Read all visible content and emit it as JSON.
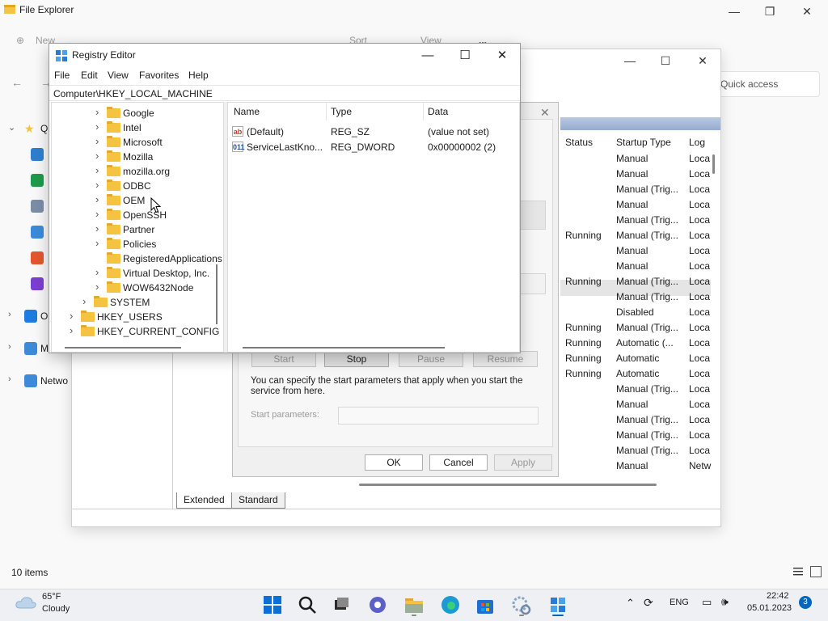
{
  "file_explorer": {
    "title": "File Explorer",
    "toolbar": {
      "new": "New",
      "sort": "Sort",
      "view": "View",
      "more": "..."
    },
    "quick_access": "Quick access",
    "nav": [
      {
        "label": "Q",
        "icon": "star-icon",
        "color": "#f5c342"
      },
      {
        "label": "",
        "icon": "desktop-icon",
        "color": "#2f7fd0"
      },
      {
        "label": "",
        "icon": "downloads-icon",
        "color": "#1e9b4b"
      },
      {
        "label": "",
        "icon": "documents-icon",
        "color": "#7b8ea8"
      },
      {
        "label": "",
        "icon": "pictures-icon",
        "color": "#3a8bdc"
      },
      {
        "label": "",
        "icon": "music-icon",
        "color": "#e4572e"
      },
      {
        "label": "",
        "icon": "videos-icon",
        "color": "#7b3fd1"
      },
      {
        "label": "O",
        "icon": "onedrive-icon",
        "color": "#1e7be0"
      },
      {
        "label": "M",
        "icon": "this-pc-icon",
        "color": "#3d8bd8"
      },
      {
        "label": "Netwo",
        "icon": "network-icon",
        "color": "#3d8bd8"
      }
    ],
    "status": "10 items"
  },
  "services": {
    "headers": {
      "status": "Status",
      "startup": "Startup Type",
      "log": "Log"
    },
    "rows": [
      {
        "status": "",
        "startup": "Manual",
        "log": "Loca"
      },
      {
        "status": "",
        "startup": "Manual",
        "log": "Loca"
      },
      {
        "status": "",
        "startup": "Manual (Trig...",
        "log": "Loca"
      },
      {
        "status": "",
        "startup": "Manual",
        "log": "Loca"
      },
      {
        "status": "",
        "startup": "Manual (Trig...",
        "log": "Loca"
      },
      {
        "status": "Running",
        "startup": "Manual (Trig...",
        "log": "Loca"
      },
      {
        "status": "",
        "startup": "Manual",
        "log": "Loca"
      },
      {
        "status": "",
        "startup": "Manual",
        "log": "Loca"
      },
      {
        "status": "Running",
        "startup": "Manual (Trig...",
        "log": "Loca"
      },
      {
        "status": "",
        "startup": "Manual (Trig...",
        "log": "Loca"
      },
      {
        "status": "",
        "startup": "Disabled",
        "log": "Loca"
      },
      {
        "status": "Running",
        "startup": "Manual (Trig...",
        "log": "Loca"
      },
      {
        "status": "Running",
        "startup": "Automatic (...",
        "log": "Loca"
      },
      {
        "status": "Running",
        "startup": "Automatic",
        "log": "Loca"
      },
      {
        "status": "Running",
        "startup": "Automatic",
        "log": "Loca"
      },
      {
        "status": "",
        "startup": "Manual (Trig...",
        "log": "Loca"
      },
      {
        "status": "",
        "startup": "Manual",
        "log": "Loca"
      },
      {
        "status": "",
        "startup": "Manual (Trig...",
        "log": "Loca"
      },
      {
        "status": "",
        "startup": "Manual (Trig...",
        "log": "Loca"
      },
      {
        "status": "",
        "startup": "Manual (Trig...",
        "log": "Loca"
      },
      {
        "status": "",
        "startup": "Manual",
        "log": "Netw"
      }
    ],
    "tabs": {
      "extended": "Extended",
      "standard": "Standard"
    }
  },
  "properties": {
    "buttons": {
      "start": "Start",
      "stop": "Stop",
      "pause": "Pause",
      "resume": "Resume"
    },
    "description": "You can specify the start parameters that apply when you start the service from here.",
    "param_label": "Start parameters:",
    "param_value": "",
    "ok": "OK",
    "cancel": "Cancel",
    "apply": "Apply"
  },
  "registry": {
    "title": "Registry Editor",
    "menu": [
      "File",
      "Edit",
      "View",
      "Favorites",
      "Help"
    ],
    "address": "Computer\\HKEY_LOCAL_MACHINE",
    "tree": [
      {
        "label": "Google",
        "level": 3,
        "expand": true
      },
      {
        "label": "Intel",
        "level": 3,
        "expand": true
      },
      {
        "label": "Microsoft",
        "level": 3,
        "expand": true
      },
      {
        "label": "Mozilla",
        "level": 3,
        "expand": true
      },
      {
        "label": "mozilla.org",
        "level": 3,
        "expand": true
      },
      {
        "label": "ODBC",
        "level": 3,
        "expand": true
      },
      {
        "label": "OEM",
        "level": 3,
        "expand": true
      },
      {
        "label": "OpenSSH",
        "level": 3,
        "expand": true
      },
      {
        "label": "Partner",
        "level": 3,
        "expand": true
      },
      {
        "label": "Policies",
        "level": 3,
        "expand": true
      },
      {
        "label": "RegisteredApplications",
        "level": 3,
        "expand": false
      },
      {
        "label": "Virtual Desktop, Inc.",
        "level": 3,
        "expand": true
      },
      {
        "label": "WOW6432Node",
        "level": 3,
        "expand": true
      },
      {
        "label": "SYSTEM",
        "level": 2,
        "expand": true
      },
      {
        "label": "HKEY_USERS",
        "level": 1,
        "expand": true
      },
      {
        "label": "HKEY_CURRENT_CONFIG",
        "level": 1,
        "expand": true
      }
    ],
    "columns": {
      "name": "Name",
      "type": "Type",
      "data": "Data"
    },
    "values": [
      {
        "icon": "ab",
        "name": "(Default)",
        "type": "REG_SZ",
        "data": "(value not set)"
      },
      {
        "icon": "011",
        "name": "ServiceLastKno...",
        "type": "REG_DWORD",
        "data": "0x00000002 (2)"
      }
    ]
  },
  "taskbar": {
    "weather_temp": "65°F",
    "weather_desc": "Cloudy",
    "apps": [
      {
        "name": "start-button",
        "color": "#0a6fd6",
        "active": false,
        "running": false
      },
      {
        "name": "search-button",
        "color": "#1b1b1b",
        "active": false,
        "running": false
      },
      {
        "name": "task-view-button",
        "color": "#2a2a2a",
        "active": false,
        "running": false
      },
      {
        "name": "chat-button",
        "color": "#5b5fc7",
        "active": false,
        "running": false
      },
      {
        "name": "file-explorer-taskbar",
        "color": "#f5c342",
        "active": false,
        "running": true
      },
      {
        "name": "edge-taskbar",
        "color": "#1a9bd6",
        "active": false,
        "running": false
      },
      {
        "name": "store-taskbar",
        "color": "#1e6fd1",
        "active": false,
        "running": false
      },
      {
        "name": "services-taskbar",
        "color": "#8aa4bf",
        "active": false,
        "running": true
      },
      {
        "name": "regedit-taskbar",
        "color": "#2b7bd3",
        "active": true,
        "running": true
      }
    ],
    "language": "ENG",
    "time": "22:42",
    "date": "05.01.2023",
    "notifications": "3"
  }
}
